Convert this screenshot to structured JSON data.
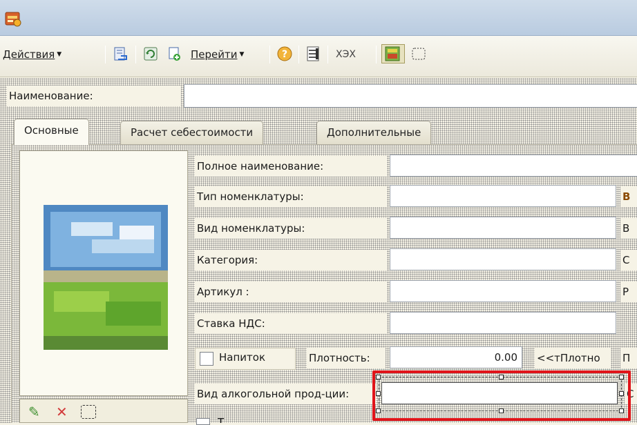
{
  "toolbar": {
    "actions_label": "Действия",
    "goto_label": "Перейти",
    "xex_label": "ХЭХ"
  },
  "header": {
    "name_label": "Наименование:",
    "name_value": ""
  },
  "tabs": [
    {
      "label": "Основные",
      "active": true
    },
    {
      "label": "Расчет себестоимости",
      "active": false
    },
    {
      "label": "Дополнительные",
      "active": false
    }
  ],
  "fields": [
    {
      "label": "Полное наименование:",
      "value": ""
    },
    {
      "label": "Тип номенклатуры:",
      "value": "",
      "side": "В"
    },
    {
      "label": "Вид номенклатуры:",
      "value": "",
      "side": "В"
    },
    {
      "label": "Категория:",
      "value": "",
      "side": "С"
    },
    {
      "label": "Артикул :",
      "value": "",
      "side": "Р"
    },
    {
      "label": "Ставка НДС:",
      "value": ""
    }
  ],
  "drink": {
    "checkbox_label": "Напиток",
    "checked": false,
    "density_label": "Плотность:",
    "density_value": "0.00",
    "density_unit": "<<тПлотно",
    "side": "П"
  },
  "alcohol": {
    "label": "Вид алкогольной прод-ции:",
    "value": "",
    "side": "С"
  },
  "next_row": {
    "label": "Т"
  },
  "colors": {
    "highlight": "#e0141a",
    "title_bg": "#c4d3e6",
    "form_bg": "#f6f3e6"
  }
}
